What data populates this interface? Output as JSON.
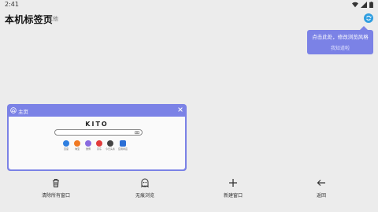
{
  "status": {
    "time": "2:41",
    "icons": [
      "wifi-icon",
      "signal-icon",
      "battery-icon"
    ]
  },
  "header": {
    "title": "本机标签页",
    "other_label": "其他",
    "sync_icon": "sync-icon"
  },
  "tip": {
    "text": "点击此处，修改浏览风格",
    "ack_label": "我知道啦"
  },
  "tab_card": {
    "title": "主页",
    "logo_text": "KITO",
    "shortcuts": [
      {
        "label": "百度",
        "color": "#2f7fe0"
      },
      {
        "label": "淘宝",
        "color": "#f07a24"
      },
      {
        "label": "微博",
        "color": "#8a6be0"
      },
      {
        "label": "京东",
        "color": "#e23b3b"
      },
      {
        "label": "今日头条",
        "color": "#444444"
      },
      {
        "label": "应用商店",
        "color": "#2b6fd6"
      }
    ]
  },
  "toolbar": {
    "clear_all": "清除所有窗口",
    "incognito": "无痕浏览",
    "new_window": "新建窗口",
    "back": "返回"
  },
  "colors": {
    "accent": "#7b82e6",
    "sync": "#2f9ee0",
    "background": "#ececec"
  }
}
